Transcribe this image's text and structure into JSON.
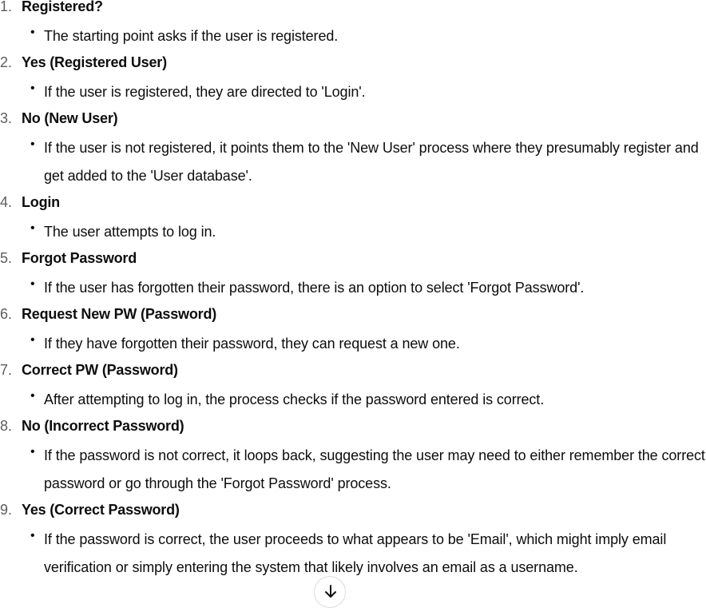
{
  "steps": [
    {
      "num": "1.",
      "title": "Registered?",
      "desc": "The starting point asks if the user is registered."
    },
    {
      "num": "2.",
      "title": "Yes (Registered User)",
      "desc": "If the user is registered, they are directed to 'Login'."
    },
    {
      "num": "3.",
      "title": "No (New User)",
      "desc": "If the user is not registered, it points them to the 'New User' process where they presumably register and get added to the 'User database'."
    },
    {
      "num": "4.",
      "title": "Login",
      "desc": "The user attempts to log in."
    },
    {
      "num": "5.",
      "title": "Forgot Password",
      "desc": "If the user has forgotten their password, there is an option to select 'Forgot Password'."
    },
    {
      "num": "6.",
      "title": "Request New PW (Password)",
      "desc": "If they have forgotten their password, they can request a new one."
    },
    {
      "num": "7.",
      "title": "Correct PW (Password)",
      "desc": "After attempting to log in, the process checks if the password entered is correct."
    },
    {
      "num": "8.",
      "title": "No (Incorrect Password)",
      "desc": "If the password is not correct, it loops back, suggesting the user may need to either remember the correct password or go through the 'Forgot Password' process."
    },
    {
      "num": "9.",
      "title": "Yes (Correct Password)",
      "desc": "If the password is correct, the user proceeds to what appears to be 'Email', which might imply email verification or simply entering the system that likely involves an email as a username."
    }
  ],
  "icons": {
    "bullet": "•",
    "scroll_button": "arrow-down-icon"
  }
}
